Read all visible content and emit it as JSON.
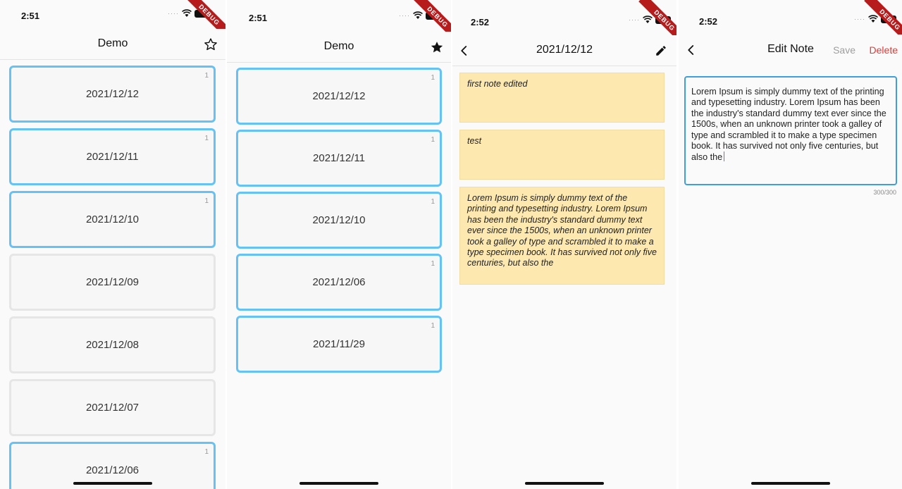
{
  "screen1": {
    "time": "2:51",
    "ribbon": "DEBUG",
    "title": "Demo",
    "star_icon": "star-outline-icon",
    "cards": [
      {
        "date": "2021/12/12",
        "count": "1",
        "highlighted": true
      },
      {
        "date": "2021/12/11",
        "count": "1",
        "highlighted": true
      },
      {
        "date": "2021/12/10",
        "count": "1",
        "highlighted": true
      },
      {
        "date": "2021/12/09",
        "count": "",
        "highlighted": false
      },
      {
        "date": "2021/12/08",
        "count": "",
        "highlighted": false
      },
      {
        "date": "2021/12/07",
        "count": "",
        "highlighted": false
      },
      {
        "date": "2021/12/06",
        "count": "1",
        "highlighted": true
      }
    ]
  },
  "screen2": {
    "time": "2:51",
    "ribbon": "DEBUG",
    "title": "Demo",
    "star_icon": "star-filled-icon",
    "cards": [
      {
        "date": "2021/12/12",
        "count": "1"
      },
      {
        "date": "2021/12/11",
        "count": "1"
      },
      {
        "date": "2021/12/10",
        "count": "1"
      },
      {
        "date": "2021/12/06",
        "count": "1"
      },
      {
        "date": "2021/11/29",
        "count": "1"
      }
    ]
  },
  "screen3": {
    "time": "2:52",
    "ribbon": "DEBUG",
    "title": "2021/12/12",
    "notes": [
      "first note edited",
      "test",
      "Lorem Ipsum is simply dummy text of the printing and typesetting industry. Lorem Ipsum has been the industry's standard dummy text ever since the 1500s, when an unknown printer took a galley of type and scrambled it to make a type specimen book. It has survived not only five centuries, but also the"
    ]
  },
  "screen4": {
    "time": "2:52",
    "ribbon": "DEBUG",
    "title": "Edit Note",
    "save_label": "Save",
    "delete_label": "Delete",
    "editor_text": "Lorem Ipsum is simply dummy text of the printing and typesetting industry. Lorem Ipsum has been the industry's standard dummy text ever since the 1500s, when an unknown printer took a galley of type and scrambled it to make a type specimen book. It has survived not only five centuries, but also the",
    "char_counter": "300/300"
  },
  "colors": {
    "accent_border": "#64c3f4",
    "note_background": "#fde8b0",
    "delete_red": "#e53935",
    "save_disabled": "#9e9e9e",
    "editor_border": "#3f9ee0",
    "debug_ribbon": "#b71c1c"
  }
}
